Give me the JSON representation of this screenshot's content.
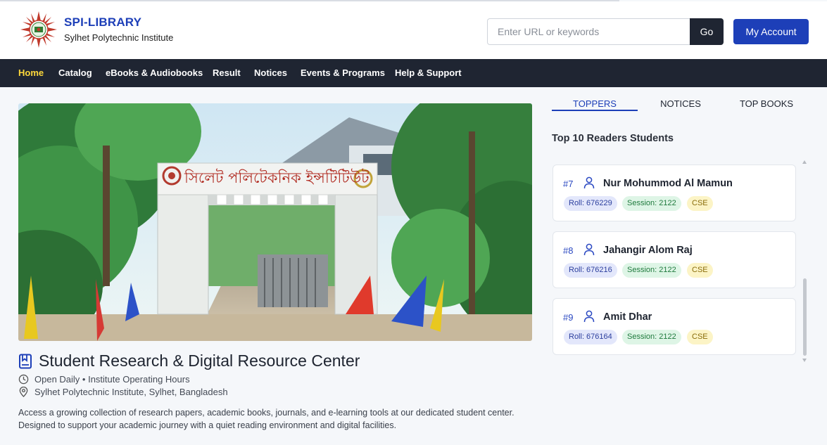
{
  "header": {
    "brand_title": "SPI-LIBRARY",
    "brand_subtitle": "Sylhet Polytechnic Institute",
    "search_placeholder": "Enter URL or keywords",
    "search_value": "",
    "go_label": "Go",
    "account_label": "My Account"
  },
  "nav": {
    "items": [
      {
        "label": "Home",
        "active": true
      },
      {
        "label": "Catalog"
      },
      {
        "label": "eBooks & Audiobooks"
      },
      {
        "label": "Result"
      },
      {
        "label": "Notices"
      },
      {
        "label": "Events & Programs"
      },
      {
        "label": "Help & Support"
      }
    ]
  },
  "hero": {
    "title": "Student Research & Digital Resource Center",
    "hours": "Open Daily • Institute Operating Hours",
    "location": "Sylhet Polytechnic Institute, Sylhet, Bangladesh",
    "description": "Access a growing collection of research papers, academic books, journals, and e-learning tools at our dedicated student center. Designed to support your academic journey with a quiet reading environment and digital facilities.",
    "gate_sign": "সিলেট পলিটেকনিক ইন্সটিটিউট"
  },
  "sidebar": {
    "tabs": [
      {
        "label": "TOPPERS",
        "active": true
      },
      {
        "label": "NOTICES"
      },
      {
        "label": "TOP BOOKS"
      }
    ],
    "heading": "Top 10 Readers Students",
    "readers": [
      {
        "rank": "#7",
        "name": "Nur Mohummod Al Mamun",
        "roll": "Roll: 676229",
        "session": "Session: 2122",
        "dept": "CSE"
      },
      {
        "rank": "#8",
        "name": "Jahangir Alom Raj",
        "roll": "Roll: 676216",
        "session": "Session: 2122",
        "dept": "CSE"
      },
      {
        "rank": "#9",
        "name": "Amit Dhar",
        "roll": "Roll: 676164",
        "session": "Session: 2122",
        "dept": "CSE"
      }
    ]
  },
  "colors": {
    "brand": "#1d3fb8",
    "nav_bg": "#1f2532",
    "nav_active": "#ffd93b",
    "page_bg": "#f5f7fa"
  }
}
